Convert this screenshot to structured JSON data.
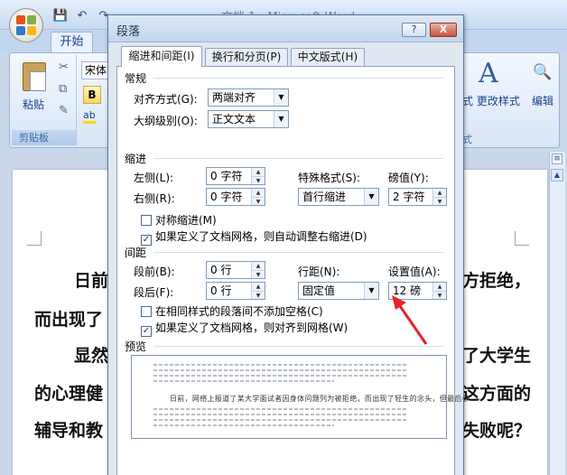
{
  "window": {
    "title": "文档 1 - Microsoft Word",
    "home_tab": "开始"
  },
  "ribbon": {
    "font_name": "宋体",
    "paste_label": "粘贴",
    "clipboard_group": "剪贴板",
    "bold_label": "B",
    "highlight_label": "ab",
    "styles_icon": "A",
    "change_styles": "式 更改样式",
    "styles_group_tail": "式",
    "editing_label": "编辑"
  },
  "document": {
    "lines": [
      {
        "left": "日前",
        "right": "方拒绝，"
      },
      {
        "left": "而出现了",
        "right": ""
      },
      {
        "left": "显然",
        "right": "了大学生"
      },
      {
        "left": "的心理健",
        "right": "这方面的"
      },
      {
        "left": "辅导和教",
        "right": "失败呢？"
      }
    ]
  },
  "dialog": {
    "title": "段落",
    "help_btn": "?",
    "close_btn": "X",
    "tabs": [
      {
        "label": "缩进和间距(I)",
        "active": true
      },
      {
        "label": "换行和分页(P)",
        "active": false
      },
      {
        "label": "中文版式(H)",
        "active": false
      }
    ],
    "general": {
      "heading": "常规",
      "alignment_label": "对齐方式(G):",
      "alignment_value": "两端对齐",
      "outline_label": "大纲级别(O):",
      "outline_value": "正文文本"
    },
    "indent": {
      "heading": "缩进",
      "left_label": "左侧(L):",
      "left_value": "0 字符",
      "right_label": "右侧(R):",
      "right_value": "0 字符",
      "special_label": "特殊格式(S):",
      "special_value": "首行缩进",
      "by_label": "磅值(Y):",
      "by_value": "2 字符",
      "mirror_label": "对称缩进(M)",
      "mirror_checked": false,
      "auto_right_label": "如果定义了文档网格，则自动调整右缩进(D)",
      "auto_right_checked": true
    },
    "spacing": {
      "heading": "间距",
      "before_label": "段前(B):",
      "before_value": "0 行",
      "after_label": "段后(F):",
      "after_value": "0 行",
      "line_spacing_label": "行距(N):",
      "line_spacing_value": "固定值",
      "at_label": "设置值(A):",
      "at_value": "12 磅",
      "no_space_label": "在相同样式的段落间不添加空格(C)",
      "no_space_checked": false,
      "snap_grid_label": "如果定义了文档网格，则对齐到网格(W)",
      "snap_grid_checked": true
    },
    "preview": {
      "heading": "预览",
      "sample_text": "日前，网络上报道了某大学面试者因身体问题列为被拒绝，而出现了轻生的念头，但最后参..."
    }
  },
  "colors": {
    "accent_arrow": "#e4242b",
    "dialog_bg": "#dfe7f1",
    "ribbon_text": "#15428b"
  }
}
